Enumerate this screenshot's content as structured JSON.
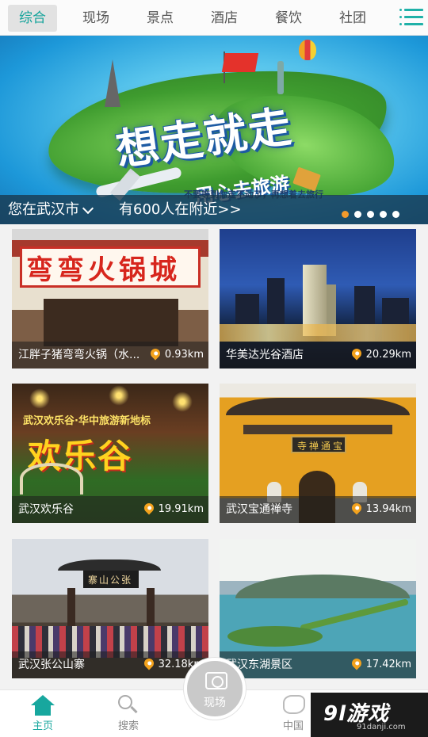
{
  "tabs": [
    {
      "label": "综合",
      "active": true
    },
    {
      "label": "现场",
      "active": false
    },
    {
      "label": "景点",
      "active": false
    },
    {
      "label": "酒店",
      "active": false
    },
    {
      "label": "餐饮",
      "active": false
    },
    {
      "label": "社团",
      "active": false
    }
  ],
  "menu_icon": "list-menu-icon",
  "banner": {
    "title": "想走就走",
    "subtitle": "用心去旅游",
    "slogan": "不要等到你走不动了，再想着去旅行",
    "location_text": "您在武汉市",
    "nearby_text": "有600人在附近>>",
    "slide_count": 5,
    "active_slide": 1
  },
  "cards": [
    {
      "name": "江胖子猪弯弯火锅（水...",
      "distance": "0.93km",
      "scene": "hotpot",
      "sign": "弯弯火锅城"
    },
    {
      "name": "华美达光谷酒店",
      "distance": "20.29km",
      "scene": "hotel"
    },
    {
      "name": "武汉欢乐谷",
      "distance": "19.91km",
      "scene": "park",
      "sign_top": "武汉欢乐谷·华中旅游新地标",
      "sign_main": "欢乐谷"
    },
    {
      "name": "武汉宝通禅寺",
      "distance": "13.94km",
      "scene": "temple",
      "sign": "寺禅通宝"
    },
    {
      "name": "武汉张公山寨",
      "distance": "32.18km",
      "scene": "village",
      "sign": "寨山公张"
    },
    {
      "name": "武汉东湖景区",
      "distance": "17.42km",
      "scene": "lake"
    }
  ],
  "bottom_nav": {
    "home": "主页",
    "search": "搜索",
    "camera": "现场",
    "china": "中国"
  },
  "watermark": {
    "logo": "9l游戏",
    "url": "91danji.com"
  },
  "colors": {
    "accent": "#17a79e",
    "pin": "#f3a21d",
    "active_dot": "#f39a2c"
  }
}
